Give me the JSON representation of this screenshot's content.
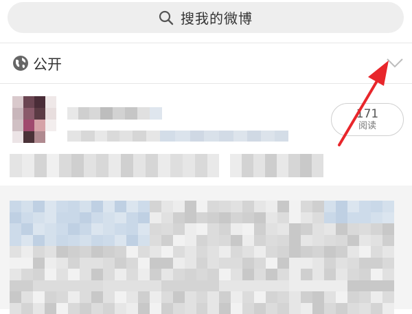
{
  "search": {
    "label": "搜我的微博"
  },
  "visibility": {
    "label": "公开"
  },
  "post": {
    "read_count": "171",
    "read_label": "阅读"
  },
  "colors": {
    "accent_arrow": "#e8262b",
    "search_bg": "#eeeeee",
    "card_bg": "#f4f4f4"
  },
  "icons": {
    "search": "search-icon",
    "visibility": "globe-icon",
    "expand": "chevron-down-icon"
  }
}
